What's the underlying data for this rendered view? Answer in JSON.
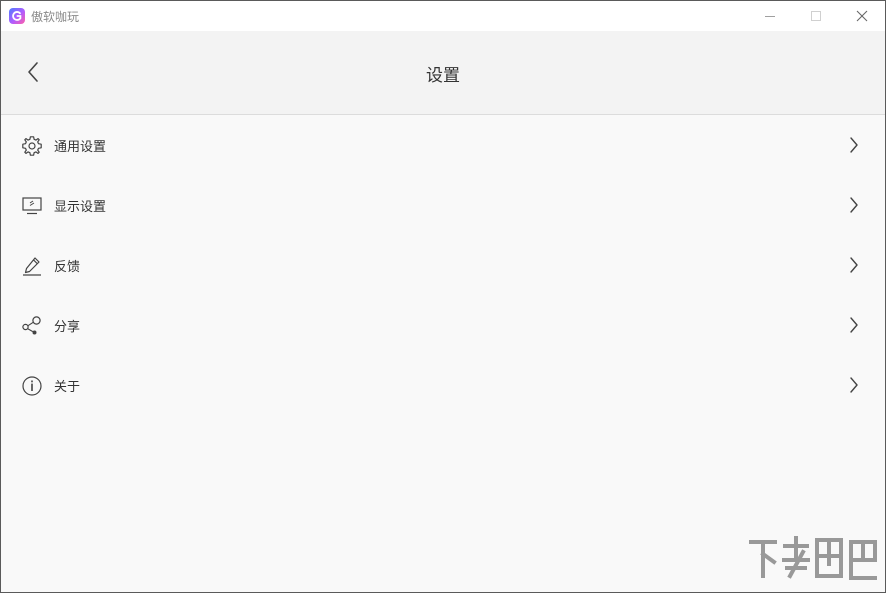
{
  "window": {
    "title": "傲软咖玩",
    "controls": [
      "minimize-icon",
      "maximize-icon",
      "close-icon"
    ]
  },
  "header": {
    "back_icon": "chevron-left-icon",
    "title": "设置"
  },
  "menu": {
    "items": [
      {
        "icon": "gear-icon",
        "label": "通用设置"
      },
      {
        "icon": "monitor-icon",
        "label": "显示设置"
      },
      {
        "icon": "pen-icon",
        "label": "反馈"
      },
      {
        "icon": "share-icon",
        "label": "分享"
      },
      {
        "icon": "info-icon",
        "label": "关于"
      }
    ],
    "chevron_icon": "chevron-right-icon"
  },
  "colors": {
    "background": "#f9f9f9",
    "header": "#f3f3f3",
    "text": "#333333",
    "icon": "#444444"
  }
}
